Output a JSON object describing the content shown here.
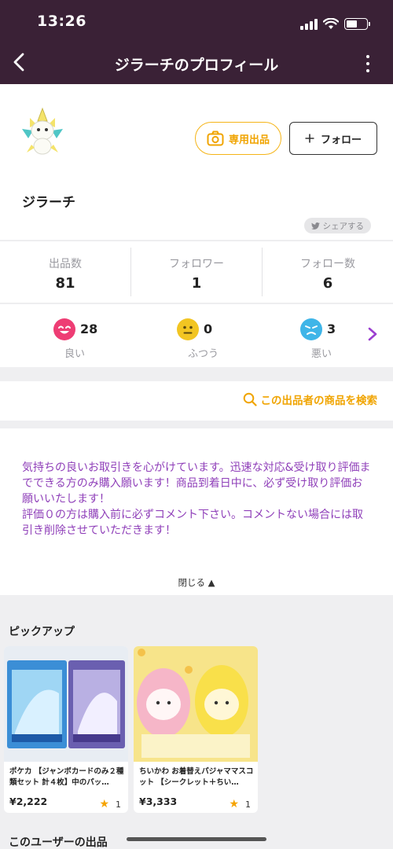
{
  "status_bar": {
    "time": "13:26"
  },
  "nav": {
    "title": "ジラーチのプロフィール"
  },
  "profile": {
    "username": "ジラーチ",
    "listing_button": "専用出品",
    "follow_button": "フォロー",
    "share_label": "シェアする"
  },
  "stats": [
    {
      "label": "出品数",
      "value": "81"
    },
    {
      "label": "フォロワー",
      "value": "1"
    },
    {
      "label": "フォロー数",
      "value": "6"
    }
  ],
  "ratings": [
    {
      "label": "良い",
      "count": "28",
      "color": "#ee3d74"
    },
    {
      "label": "ふつう",
      "count": "0",
      "color": "#f2c522"
    },
    {
      "label": "悪い",
      "count": "3",
      "color": "#3fb5e8"
    }
  ],
  "search": {
    "label": "この出品者の商品を検索"
  },
  "description": {
    "text": "気持ちの良いお取引きを心がけています。迅速な対応&受け取り評価までできる方のみ購入願います！商品到着日中に、必ず受け取り評価お願いいたします！\n評価０の方は購入前に必ずコメント下さい。コメントない場合には取引き削除させていただきます！",
    "close_label": "閉じる ▲"
  },
  "pickup": {
    "title": "ピックアップ",
    "items": [
      {
        "title": "ポケカ 【ジャンボカードのみ２種類セット 計４枚】中のパッ…",
        "price": "¥2,222",
        "likes": "1"
      },
      {
        "title": "ちいかわ お着替えパジャママスコット 【シークレット＋ちい…",
        "price": "¥3,333",
        "likes": "1"
      }
    ]
  },
  "user_listings": {
    "title": "このユーザーの出品"
  },
  "colors": {
    "nav_bg": "#3a2136",
    "accent": "#f0a400",
    "desc_text": "#8f3fb9"
  }
}
